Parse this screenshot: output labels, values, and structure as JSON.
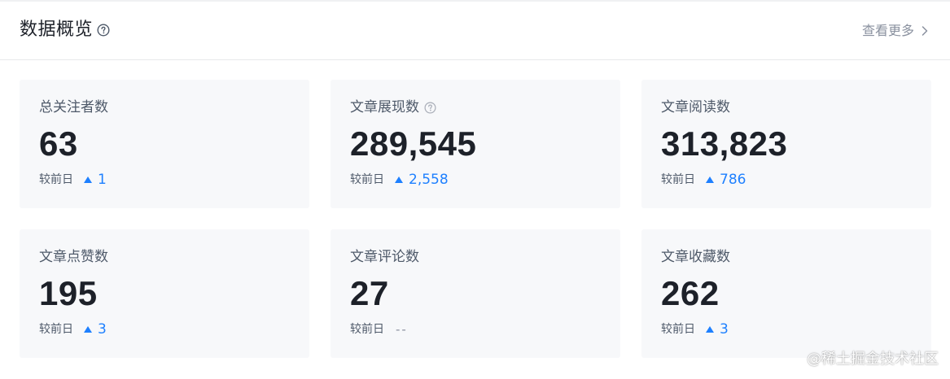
{
  "header": {
    "title": "数据概览",
    "see_more_label": "查看更多"
  },
  "compare_label": "较前日",
  "cards": [
    {
      "label": "总关注者数",
      "value": "63",
      "change": "1",
      "has_help": false
    },
    {
      "label": "文章展现数",
      "value": "289,545",
      "change": "2,558",
      "has_help": true
    },
    {
      "label": "文章阅读数",
      "value": "313,823",
      "change": "786",
      "has_help": false
    },
    {
      "label": "文章点赞数",
      "value": "195",
      "change": "3",
      "has_help": false
    },
    {
      "label": "文章评论数",
      "value": "27",
      "change": "--",
      "has_help": false
    },
    {
      "label": "文章收藏数",
      "value": "262",
      "change": "3",
      "has_help": false
    }
  ],
  "watermark": "@稀土掘金技术社区",
  "colors": {
    "accent": "#1e80ff",
    "card_bg": "#f7f8fa",
    "text_primary": "#1d2129",
    "text_secondary": "#4e5969",
    "text_muted": "#8a919f"
  }
}
